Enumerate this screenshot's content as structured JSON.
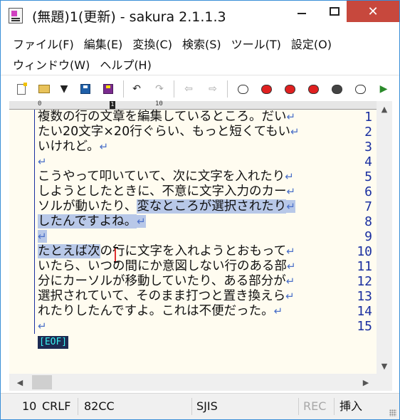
{
  "window": {
    "title": "(無題)1(更新) - sakura 2.1.1.3",
    "app_icon": "sakura-app-icon",
    "controls": {
      "minimize": "minimize-icon",
      "maximize": "maximize-icon",
      "close": "close-icon",
      "close_glyph": "✕"
    }
  },
  "menu": {
    "items": [
      "ファイル(F)",
      "編集(E)",
      "変換(C)",
      "検索(S)",
      "ツール(T)",
      "設定(O)",
      "ウィンドウ(W)",
      "ヘルプ(H)"
    ]
  },
  "toolbar": {
    "icons": [
      "new-file-icon",
      "open-folder-icon",
      "dropdown-arrow-icon",
      "save-icon",
      "save-as-icon",
      "undo-icon",
      "redo-icon",
      "back-icon",
      "forward-icon",
      "search-face-icon",
      "search-next-icon",
      "search-prev-icon",
      "grep-icon",
      "clear-icon",
      "bookmark-icon",
      "jump-icon"
    ]
  },
  "ruler": {
    "start": "0",
    "cursor_col": "1",
    "tick_10": "10"
  },
  "editor": {
    "lines": [
      {
        "num": "1",
        "text": "複数の行の文章を編集しているところ。だい",
        "eol": "↵",
        "selected": false
      },
      {
        "num": "2",
        "text": "たい20文字×20行ぐらい、もっと短くてもい",
        "eol": "↵",
        "selected": false
      },
      {
        "num": "3",
        "text": "いけれど。",
        "eol": "↵",
        "selected": false
      },
      {
        "num": "4",
        "text": "",
        "eol": "↵",
        "selected": false
      },
      {
        "num": "5",
        "text": "こうやって叩いていて、次に文字を入れたり",
        "eol": "↵",
        "selected": false
      },
      {
        "num": "6",
        "text": "しようとしたときに、不意に文字入力のカー",
        "eol": "↵",
        "selected": false
      },
      {
        "num": "7",
        "text_plain": "ソルが動いたり、",
        "text_sel": "変なところが選択されたり",
        "eol": "↵",
        "selected": "partial"
      },
      {
        "num": "8",
        "text": "したんですよね。",
        "eol": "↵",
        "selected": true
      },
      {
        "num": "9",
        "text": "",
        "eol": "↵",
        "selected": true
      },
      {
        "num": "10",
        "text_sel": "たとえば次",
        "text_plain": "の行に文字を入れようとおもって",
        "eol": "↵",
        "selected": "partial"
      },
      {
        "num": "11",
        "text": "いたら、いつの間にか意図しない行のある部",
        "eol": "↵",
        "selected": false
      },
      {
        "num": "12",
        "text": "分にカーソルが移動していたり、ある部分が",
        "eol": "↵",
        "selected": false
      },
      {
        "num": "13",
        "text": "選択されていて、そのまま打つと置き換えら",
        "eol": "↵",
        "selected": false
      },
      {
        "num": "14",
        "text": "れたりしたんですよ。これは不便だった。",
        "eol": "↵",
        "selected": false
      },
      {
        "num": "15",
        "text": "",
        "eol": "↵",
        "selected": false
      }
    ],
    "eof": "[EOF]"
  },
  "status": {
    "line": "10",
    "newline": "CRLF",
    "char_code": "82CC",
    "encoding": "SJIS",
    "rec": "REC",
    "mode": "挿入"
  }
}
